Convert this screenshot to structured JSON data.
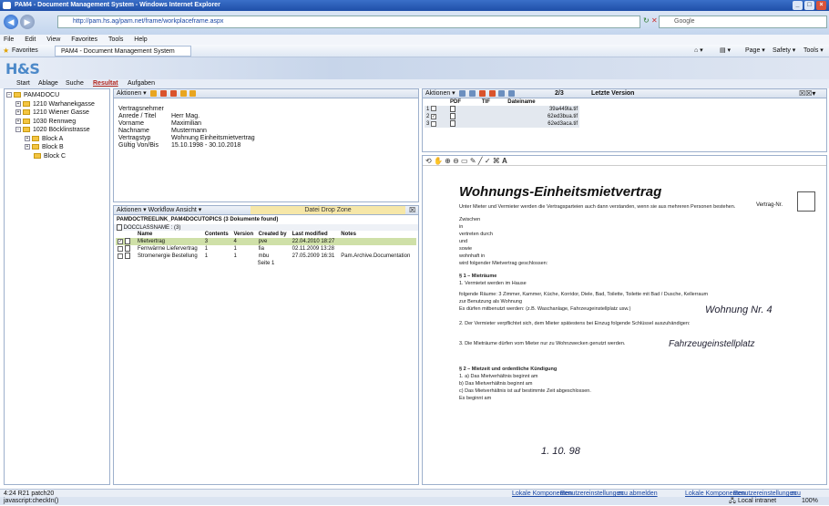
{
  "window": {
    "title": "PAM4 - Document Management System - Windows Internet Explorer",
    "controls": [
      "_",
      "□",
      "×"
    ]
  },
  "browser": {
    "url": "http://pam.hs.ag/pam.net/frame/workplaceframe.aspx",
    "search_placeholder": "Google",
    "menu": [
      "File",
      "Edit",
      "View",
      "Favorites",
      "Tools",
      "Help"
    ],
    "favorites_label": "Favorites",
    "fav_tab": "PAM4 - Document Management System",
    "cmd": [
      "Page ▾",
      "Safety ▾",
      "Tools ▾"
    ]
  },
  "app": {
    "logo": "H&S",
    "tabs": [
      "Start",
      "Ablage",
      "Suche",
      "Resultat",
      "Aufgaben"
    ],
    "active_tab": "Resultat"
  },
  "tree": {
    "items": [
      {
        "label": "PAM4DOCU",
        "level": 0,
        "toggle": "-"
      },
      {
        "label": "1210 Warhanekgasse",
        "level": 1,
        "toggle": "+"
      },
      {
        "label": "1210 Wiener Gasse",
        "level": 1,
        "toggle": "+"
      },
      {
        "label": "1030 Rennweg",
        "level": 1,
        "toggle": "+"
      },
      {
        "label": "1020 Böcklinstrasse",
        "level": 1,
        "toggle": "-"
      },
      {
        "label": "Block A",
        "level": 2,
        "toggle": "+"
      },
      {
        "label": "Block B",
        "level": 2,
        "toggle": "+"
      },
      {
        "label": "Block C",
        "level": 2,
        "toggle": ""
      }
    ]
  },
  "detail": {
    "actions": "Aktionen ▾",
    "fields": [
      {
        "k": "Vertragsnehmer",
        "v": ""
      },
      {
        "k": "Anrede / Titel",
        "v": "Herr    Mag."
      },
      {
        "k": "Vorname",
        "v": "Maximilian"
      },
      {
        "k": "Nachname",
        "v": "Mustermann"
      },
      {
        "k": "Vertragstyp",
        "v": "Wohnung Einheitsmietvertrag"
      },
      {
        "k": "Gültig Von/Bis",
        "v": "15.10.1998  -  30.10.2018"
      }
    ]
  },
  "list": {
    "menus": "Aktionen ▾  Workflow  Ansicht ▾",
    "dropzone": "Datei Drop Zone",
    "caption": "PAMDOCTREELINK_PAM4DOCUTOPICS (3 Dokumente found)",
    "group": "DOCCLASSNAME : (3)",
    "columns": [
      "Name",
      "Contents",
      "Version",
      "Created by",
      "Last modified",
      "Notes"
    ],
    "rows": [
      {
        "name": "Mietvertrag",
        "contents": "3",
        "version": "4",
        "created": "pve",
        "modified": "22.04.2010 18:27",
        "notes": "",
        "checked": true
      },
      {
        "name": "Fernwärme Liefervertrag",
        "contents": "1",
        "version": "1",
        "created": "fia",
        "modified": "02.11.2009 13:28",
        "notes": "",
        "checked": false
      },
      {
        "name": "Stromenergie Bestellung",
        "contents": "1",
        "version": "1",
        "created": "mbu",
        "modified": "27.05.2009 16:31",
        "notes": "Pam.Archive.Documentation",
        "checked": false
      }
    ],
    "page": "Seite 1"
  },
  "files": {
    "actions": "Aktionen ▾",
    "counter": "2/3",
    "version": "Letzte Version",
    "columns": [
      "PDF",
      "TIF",
      "Dateiname"
    ],
    "rows": [
      {
        "n": "1",
        "checked": false,
        "file": "39a449la.tif"
      },
      {
        "n": "2",
        "checked": true,
        "file": "62ed3bua.tif"
      },
      {
        "n": "3",
        "checked": false,
        "file": "62ed3aca.tif"
      }
    ]
  },
  "scan": {
    "title": "Wohnungs-Einheitsmietvertrag",
    "vertragnr": "Vertrag-Nr.",
    "lines": [
      "Unter Mieter und Vermieter werden die Vertragsparteien auch dann verstanden, wenn sie aus mehreren Personen bestehen.",
      "Zwischen",
      "in",
      "vertreten durch",
      "und",
      "sowie",
      "wohnhaft in",
      "wird folgender Mietvertrag geschlossen:",
      "§ 1 – Mieträume",
      "1. Vermietet werden im Hause",
      "folgende Räume: 3 Zimmer, Kammer, Küche, Korridor, Diele, Bad, Toilette, Toilette mit Bad / Dusche, Kellerraum",
      "zur Benutzung als Wohnung",
      "Es dürfen mitbenutzt werden: (z.B. Waschanlage, Fahrzeugeinstellplatz usw.)",
      "2. Der Vermieter verpflichtet sich, dem Mieter spätestens bei Einzug folgende Schlüssel auszuhändigen:",
      "3. Die Mieträume dürfen vom Mieter nur zu Wohnzwecken genutzt werden.",
      "§ 2 – Mietzeit und ordentliche Kündigung",
      "1. a) Das Mietverhältnis beginnt am",
      "b) Das Mietverhältnis beginnt am",
      "c) Das Mietverhältnis ist auf bestimmte Zeit abgeschlossen.",
      "Es beginnt am"
    ],
    "hand": [
      "Wohnung Nr. 4",
      "Fahrzeugeinstellplatz",
      "1. 10. 98"
    ]
  },
  "status": {
    "left": "4:24 R21 patch20",
    "links": [
      "Lokale Komponenten",
      "Benutzereinstellungen",
      "zcu abmelden"
    ],
    "links2": [
      "Lokale Komponenten",
      "Benutzereinstellungen",
      "zcu abmelden"
    ],
    "bottom": "javascript:checkIn()",
    "zone": "Local intranet",
    "zoom": "100%"
  }
}
